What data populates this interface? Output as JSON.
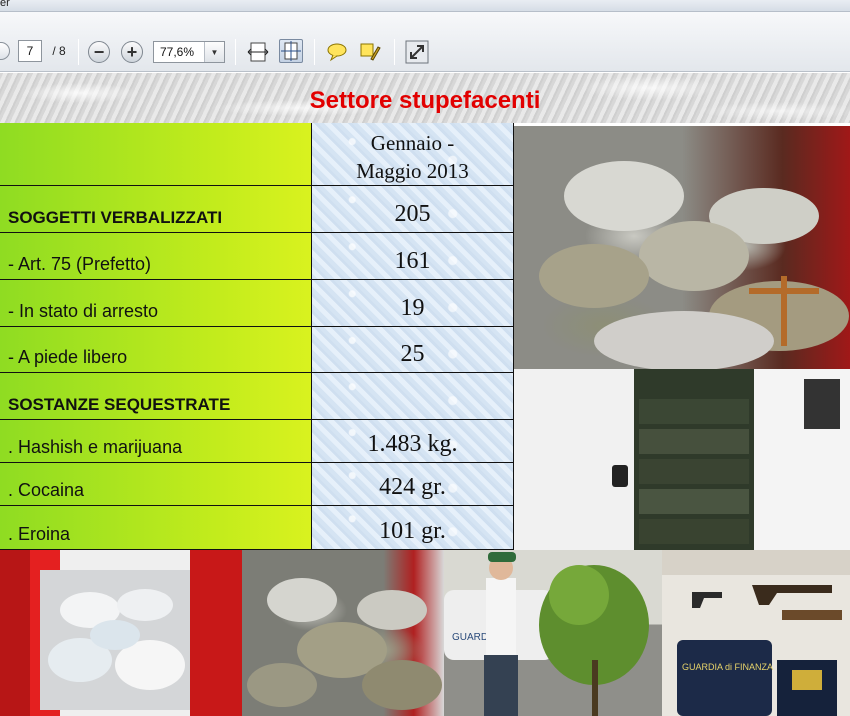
{
  "window": {
    "title_fragment": "er"
  },
  "toolbar": {
    "page_current": "7",
    "page_total": "/ 8",
    "zoom_out_label": "−",
    "zoom_in_label": "+",
    "zoom_value": "77,6%",
    "zoom_dropdown_arrow": "▼",
    "icons": [
      "prev-page-icon",
      "zoom-out-icon",
      "zoom-in-icon",
      "fit-width-icon",
      "fit-page-icon",
      "comment-icon",
      "highlight-icon",
      "fullscreen-icon"
    ]
  },
  "slide": {
    "title": "Settore stupefacenti",
    "title_color": "#e20000",
    "header_period": "Gennaio - Maggio 2013",
    "rows": [
      {
        "label": "SOGGETTI VERBALIZZATI",
        "value": "205",
        "bold": true
      },
      {
        "label": "- Art. 75 (Prefetto)",
        "value": "161",
        "bold": false
      },
      {
        "label": "- In stato di arresto",
        "value": "19",
        "bold": false
      },
      {
        "label": "- A piede libero",
        "value": "25",
        "bold": false
      },
      {
        "label": "SOSTANZE SEQUESTRATE",
        "value": "",
        "bold": true
      },
      {
        "label": ". Hashish e marijuana",
        "value": "1.483 kg.",
        "bold": false
      },
      {
        "label": ". Cocaina",
        "value": "424 gr.",
        "bold": false
      },
      {
        "label": ". Eroina",
        "value": "101 gr.",
        "bold": false
      }
    ],
    "photos": {
      "p6_text": "GUARDIA di FINANZA",
      "p5_car_text": "GUARDIA"
    }
  }
}
